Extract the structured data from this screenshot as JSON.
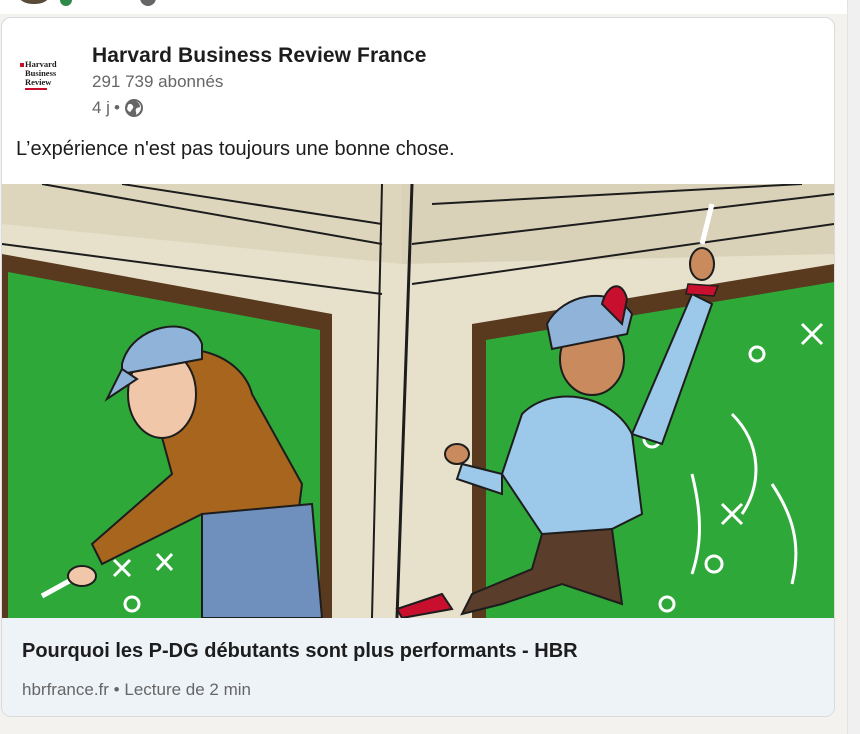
{
  "post": {
    "author_name": "Harvard Business Review France",
    "followers": "291 739 abonnés",
    "age": "4 j",
    "separator": "•",
    "visibility_icon": "globe-icon",
    "text": "L’expérience n'est pas toujours une bonne chose.",
    "logo_lines": [
      "Harvard",
      "Business",
      "Review"
    ]
  },
  "link_preview": {
    "title": "Pourquoi les P-DG débutants sont plus performants - HBR",
    "source": "hbrfrance.fr",
    "reading_time": "Lecture de 2 min"
  },
  "colors": {
    "accent_red": "#c8102e",
    "chalkboard_green": "#2fa83a",
    "link_box_bg": "#eef3f8"
  }
}
